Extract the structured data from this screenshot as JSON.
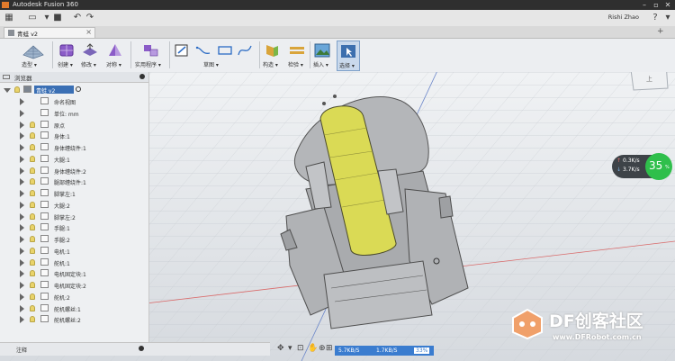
{
  "window": {
    "app_title": "Autodesk Fusion 360",
    "user": "Rishi Zhao"
  },
  "doc_tab": {
    "label": "青蛙 v2"
  },
  "ribbon": {
    "workspace": "造型 ▾",
    "groups": [
      "创建 ▾",
      "修改 ▾",
      "对称 ▾",
      "实用程序 ▾",
      "草图 ▾",
      "构造 ▾",
      "检验 ▾",
      "插入 ▾",
      "选择 ▾"
    ]
  },
  "browser": {
    "title": "浏览器",
    "root": "青蛙 v2",
    "items": [
      "命名视图",
      "单位: mm",
      "原点",
      "身体:1",
      "身体缠绕件:1",
      "大腿:1",
      "身体缠绕件:2",
      "腿部缠绕件:1",
      "脚掌左:1",
      "大腿:2",
      "脚掌左:2",
      "手腿:1",
      "手腿:2",
      "电机:1",
      "舵机:1",
      "电机固定块:1",
      "电机固定块:2",
      "舵机:2",
      "舵机螺丝:1",
      "舵机螺丝:2"
    ]
  },
  "comments": {
    "label": "注释"
  },
  "overlay": {
    "upload": "0.3K/s",
    "download": "3.7K/s",
    "percent": "35",
    "percent_unit": "%",
    "net_down": "5.7KB/S",
    "net_up": "1.7KB/S",
    "net_pct": "33%"
  },
  "watermark": {
    "brand": "DF创客社区",
    "url": "www.DFRobot.com.cn"
  },
  "viewcube": {
    "face": "上"
  },
  "colors": {
    "accent": "#3a7ccf",
    "model_body": "#b3b3b3",
    "highlight": "#dada55",
    "title_bar": "#2f2f2f"
  }
}
